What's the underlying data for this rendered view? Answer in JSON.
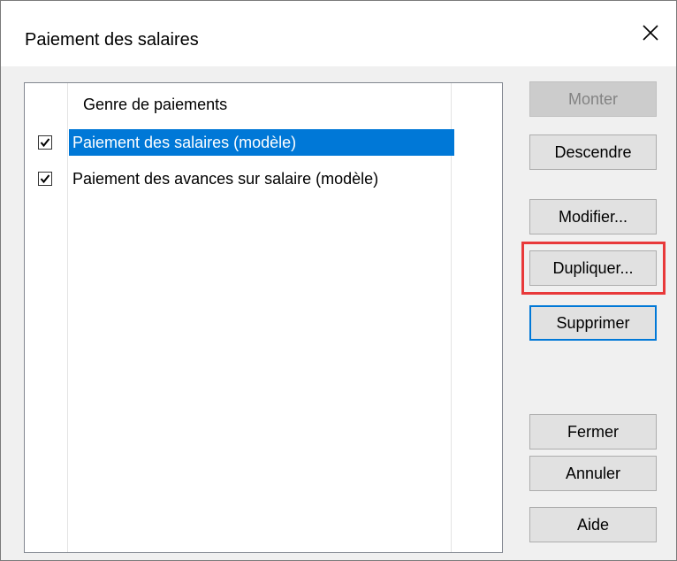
{
  "window": {
    "title": "Paiement des salaires",
    "close_icon": "close-icon"
  },
  "list": {
    "column_header": "Genre de paiements",
    "rows": [
      {
        "label": "Paiement des salaires (modèle)",
        "checked": true,
        "selected": true
      },
      {
        "label": "Paiement des avances sur salaire (modèle)",
        "checked": true,
        "selected": false
      }
    ]
  },
  "buttons": {
    "up": "Monter",
    "down": "Descendre",
    "edit": "Modifier...",
    "duplicate": "Dupliquer...",
    "delete": "Supprimer",
    "close": "Fermer",
    "cancel": "Annuler",
    "help": "Aide"
  },
  "colors": {
    "selection": "#0078d7",
    "highlight": "#e8393a"
  }
}
